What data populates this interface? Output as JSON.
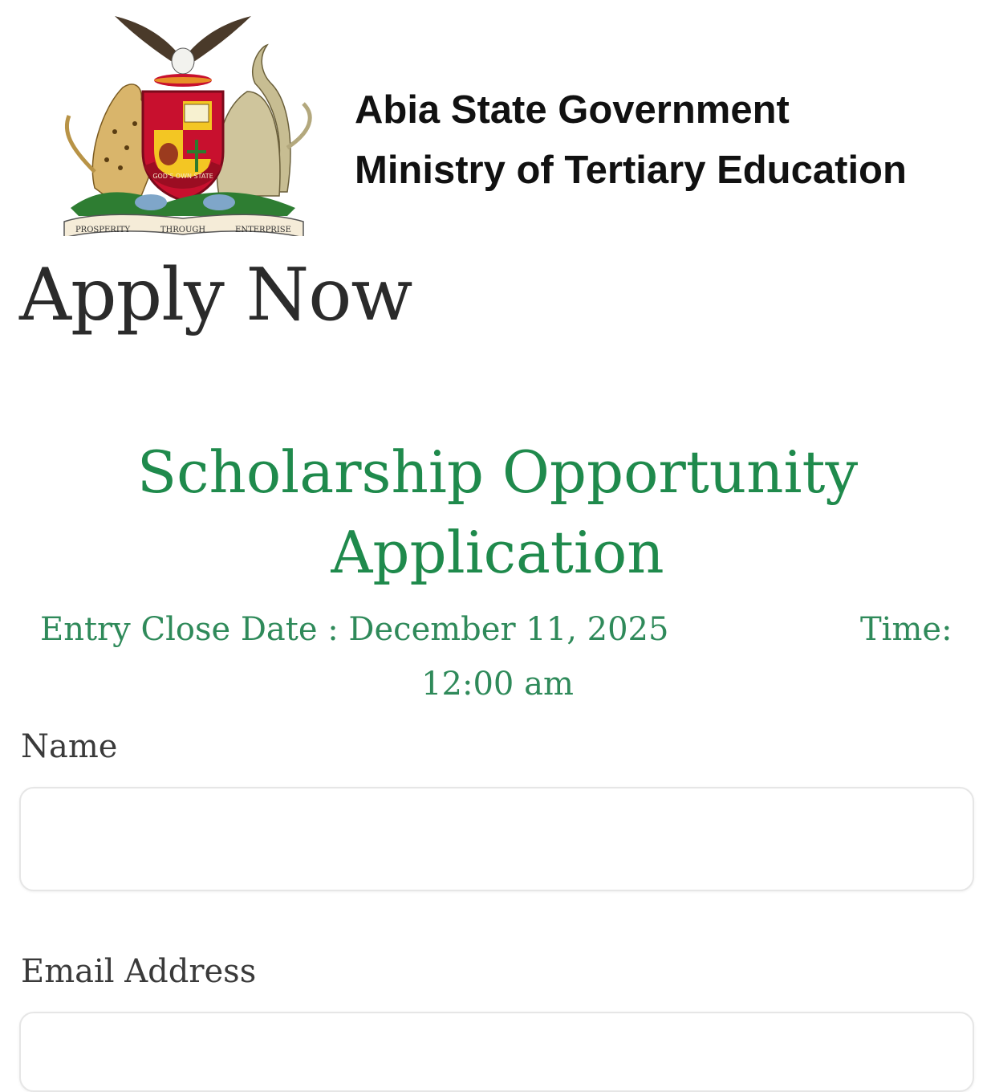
{
  "header": {
    "government": "Abia State Government",
    "ministry": "Ministry of Tertiary Education",
    "crest": {
      "icon": "abia-state-coat-of-arms",
      "banner_ring": "GOD'S OWN STATE",
      "motto": [
        "PROSPERITY",
        "THROUGH",
        "ENTERPRISE"
      ]
    }
  },
  "page": {
    "heading": "Apply Now"
  },
  "form": {
    "title_line1": "Scholarship Opportunity",
    "title_line2": "Application",
    "close_date": "Entry Close Date : December 11, 2025",
    "time_label": "Time:",
    "time_value": "12:00 am",
    "fields": {
      "name": {
        "label": "Name",
        "value": "",
        "placeholder": ""
      },
      "email": {
        "label": "Email Address",
        "value": "",
        "placeholder": ""
      }
    }
  },
  "colors": {
    "title_green": "#1f8a4c",
    "info_green": "#2f8a5a",
    "heading_text": "#2b2b2b"
  }
}
